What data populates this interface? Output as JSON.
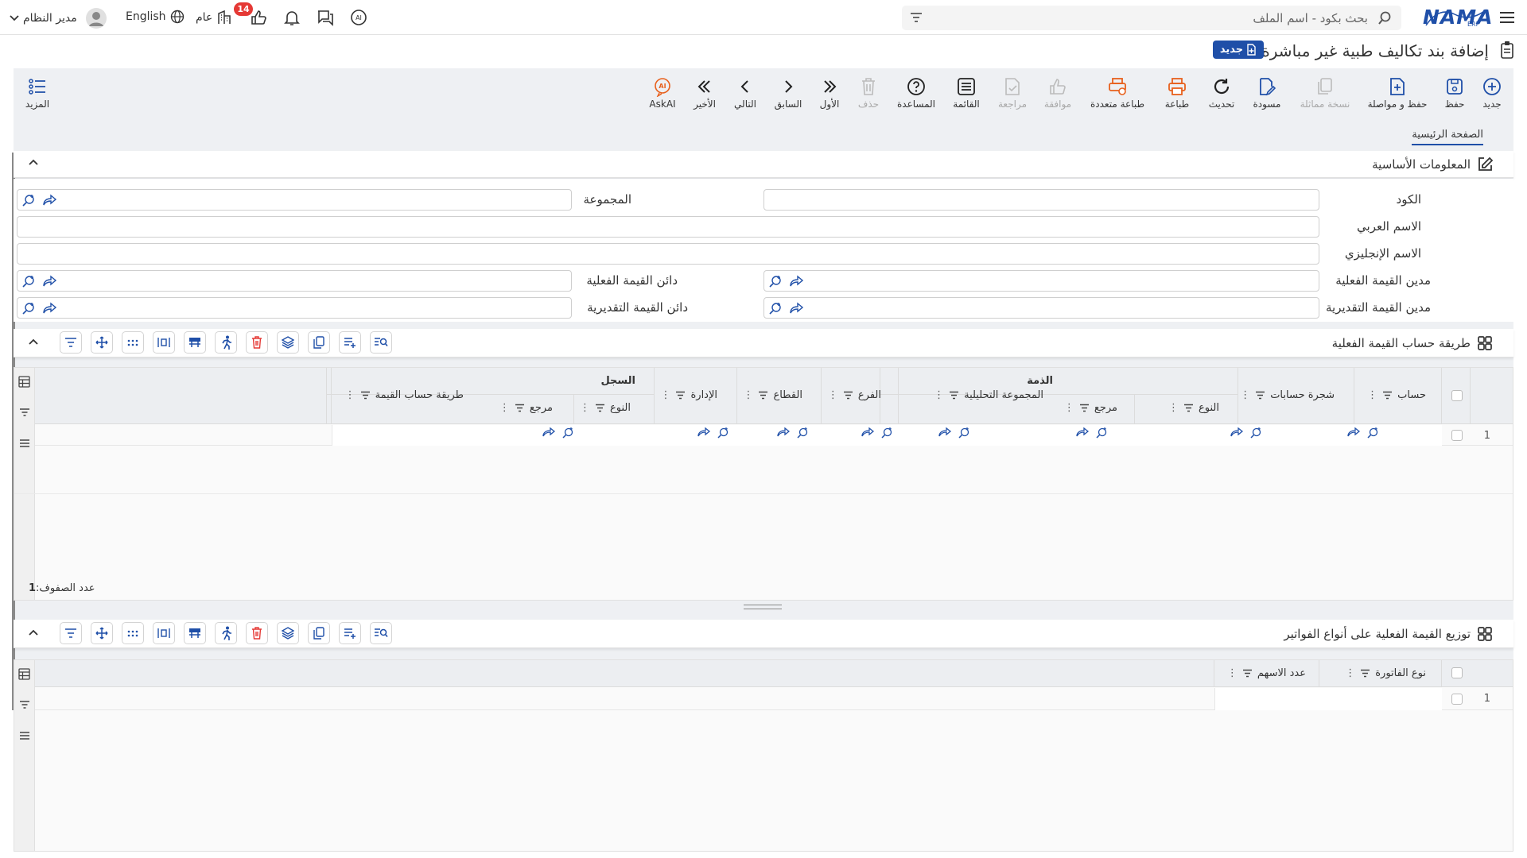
{
  "app": {
    "logo_text": "NAMA",
    "logo_sub": "ERP"
  },
  "search": {
    "placeholder": "بحث بكود - اسم الملف"
  },
  "topbar": {
    "notifications_count": "14",
    "public_label": "عام",
    "language_label": "English",
    "user_label": "مدير النظام"
  },
  "page": {
    "title": "إضافة بند تكاليف طبية غير مباشرة",
    "badge": "جديد"
  },
  "toolbar": {
    "new": "جديد",
    "save": "حفظ",
    "save_continue": "حفظ و مواصلة",
    "duplicate": "نسخة مماثلة",
    "draft": "مسودة",
    "refresh": "تحديث",
    "print": "طباعة",
    "multi_print": "طباعة متعددة",
    "approve": "موافقة",
    "review": "مراجعة",
    "list": "القائمة",
    "help": "المساعدة",
    "delete": "حذف",
    "first": "الأول",
    "prev": "السابق",
    "next": "التالي",
    "last": "الأخير",
    "askai": "AskAI",
    "more": "المزيد"
  },
  "tabs": {
    "home": "الصفحة الرئيسية"
  },
  "basic": {
    "title": "المعلومات الأساسية",
    "code": "الكود",
    "group": "المجموعة",
    "arabic_name": "الاسم العربي",
    "english_name": "الاسم الإنجليزي",
    "actual_debit": "مدين القيمة الفعلية",
    "actual_credit": "دائن القيمة الفعلية",
    "est_debit": "مدين القيمة التقديرية",
    "est_credit": "دائن القيمة التقديرية"
  },
  "grid1": {
    "title": "طريقة حساب القيمة الفعلية",
    "group_dhimma": "الذمة",
    "group_record": "السجل",
    "col_account": "حساب",
    "col_tree": "شجرة حسابات",
    "col_type": "النوع",
    "col_ref": "مرجع",
    "col_analytic": "المجموعة التحليلية",
    "col_branch": "الفرع",
    "col_sector": "القطاع",
    "col_dept": "الإدارة",
    "col_rec_type": "النوع",
    "col_rec_ref": "مرجع",
    "col_method": "طريقة حساب القيمة",
    "row_no": "1",
    "row_count_label": "عدد الصفوف:",
    "row_count": "1"
  },
  "grid2": {
    "title": "توزيع القيمة الفعلية على أنواع الفواتير",
    "col_invoice_type": "نوع الفاتورة",
    "col_shares": "عدد الاسهم",
    "row_no": "1"
  },
  "colors": {
    "primary": "#1f4fa8",
    "accent": "#e8601c",
    "badge_red": "#e53935"
  }
}
